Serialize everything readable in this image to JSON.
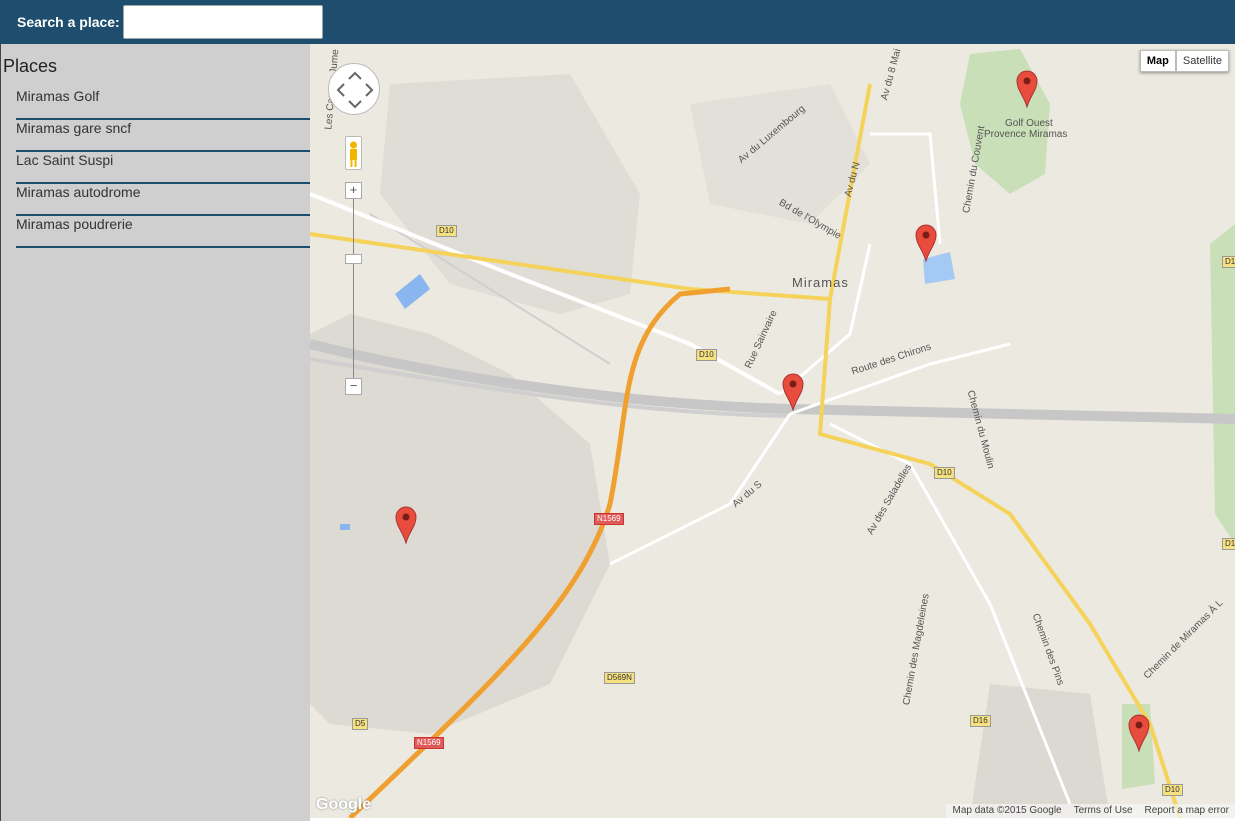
{
  "header": {
    "search_label": "Search a place:",
    "search_value": "",
    "search_placeholder": ""
  },
  "sidebar": {
    "title": "Places",
    "items": [
      {
        "label": "Miramas Golf"
      },
      {
        "label": "Miramas gare sncf"
      },
      {
        "label": "Lac Saint Suspi"
      },
      {
        "label": "Miramas autodrome"
      },
      {
        "label": "Miramas poudrerie"
      }
    ]
  },
  "map": {
    "type_buttons": {
      "map": "Map",
      "satellite": "Satellite"
    },
    "zoom_in": "+",
    "zoom_out": "−",
    "town": "Miramas",
    "golf_label_line1": "Golf Ouest",
    "golf_label_line2": "Provence Miramas",
    "streets": {
      "av_luxembourg": "Av du Luxembourg",
      "bd_olympie": "Bd de l'Olympie",
      "rue_sainvaire": "Rue Sainvaire",
      "route_chirons": "Route des Chirons",
      "chemin_moulin": "Chemin du Moulin",
      "chemin_couvent": "Chemin du Couvent",
      "av_saladelles": "Av des Saladelles",
      "av_du_s": "Av du S",
      "av_du_n": "Av du N",
      "av_8_mai": "Av du 8 Mai",
      "chemin_magdeleines": "Chemin des Magdeleines",
      "chemin_pins": "Chemin des Pins",
      "chemin_miramas": "Chemin de Miramas À L",
      "canaux": "Les Canaux Jume"
    },
    "roads": {
      "d10": "D10",
      "n1569": "N1569",
      "d569n": "D569N",
      "d5": "D5",
      "d16": "D16",
      "d1": "D1"
    },
    "footer": {
      "data": "Map data ©2015 Google",
      "terms": "Terms of Use",
      "report": "Report a map error"
    },
    "logo": "Google",
    "colors": {
      "header": "#1e4d6e",
      "sidebar": "#cfcfcf",
      "marker": "#e74c3c",
      "highway": "#f0a030",
      "main_road": "#f5d35a"
    }
  }
}
